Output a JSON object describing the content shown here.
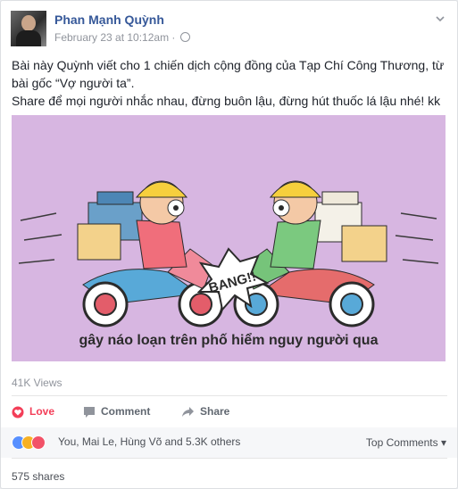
{
  "post": {
    "author": "Phan Mạnh Quỳnh",
    "timestamp": "February 23 at 10:12am",
    "separator": " · ",
    "text_line1": "Bài này Quỳnh viết cho 1 chiến dịch cộng đồng của Tạp Chí Công Thương, từ bài gốc “Vợ người ta”.",
    "text_line2": "Share để mọi người nhắc nhau, đừng buôn lậu, đừng hút thuốc lá lậu nhé! kk",
    "image": {
      "bang_text": "BANG!!",
      "caption": "gây náo loạn trên phố hiểm nguy người qua",
      "background": "#d7b6e1"
    },
    "views": "41K Views"
  },
  "actions": {
    "love": "Love",
    "comment": "Comment",
    "share": "Share",
    "love_color": "#f33e58"
  },
  "reactions": {
    "summary": "You, Mai Le, Hùng Võ and 5.3K others",
    "top_comments": "Top Comments",
    "icons": [
      "like-icon",
      "haha-icon",
      "love-icon"
    ]
  },
  "shares": "575 shares"
}
